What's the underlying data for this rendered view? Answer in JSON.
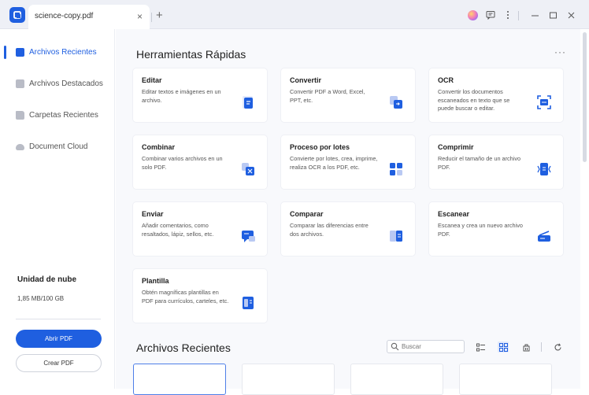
{
  "titlebar": {
    "tab_title": "science-copy.pdf",
    "close_glyph": "×",
    "new_tab_glyph": "+",
    "icons": [
      "app-logo-icon",
      "avatar-icon",
      "feedback-icon",
      "kebab-menu-icon",
      "minimize-icon",
      "maximize-icon",
      "close-icon"
    ]
  },
  "sidebar": {
    "items": [
      {
        "label": "Archivos Recientes",
        "icon": "recent-files-icon",
        "active": true
      },
      {
        "label": "Archivos Destacados",
        "icon": "starred-files-icon",
        "active": false
      },
      {
        "label": "Carpetas Recientes",
        "icon": "folder-icon",
        "active": false
      },
      {
        "label": "Document Cloud",
        "icon": "cloud-icon",
        "active": false
      }
    ],
    "cloud_title": "Unidad de nube",
    "cloud_usage": "1,85 MB/100 GB",
    "open_button": "Abrir PDF",
    "create_button": "Crear PDF"
  },
  "main": {
    "quick_tools_title": "Herramientas Rápidas",
    "more_glyph": "···",
    "tools": [
      {
        "title": "Editar",
        "desc": "Editar textos e imágenes en un archivo.",
        "icon": "edit-icon"
      },
      {
        "title": "Convertir",
        "desc": "Convertir PDF a Word, Excel, PPT, etc.",
        "icon": "convert-icon"
      },
      {
        "title": "OCR",
        "desc": "Convertir los documentos escaneados en texto que se puede buscar o editar.",
        "icon": "ocr-icon"
      },
      {
        "title": "Combinar",
        "desc": "Combinar varios archivos en un solo PDF.",
        "icon": "combine-icon"
      },
      {
        "title": "Proceso por lotes",
        "desc": "Convierte por lotes, crea, imprime, realiza OCR a los PDF, etc.",
        "icon": "batch-icon"
      },
      {
        "title": "Comprimir",
        "desc": "Reducir el tamaño de un archivo PDF.",
        "icon": "compress-icon"
      },
      {
        "title": "Enviar",
        "desc": "Añadir comentarios, como resaltados, lápiz, sellos, etc.",
        "icon": "send-icon"
      },
      {
        "title": "Comparar",
        "desc": "Comparar las diferencias entre dos archivos.",
        "icon": "compare-icon"
      },
      {
        "title": "Escanear",
        "desc": "Escanea y crea un nuevo archivo PDF.",
        "icon": "scanner-icon"
      },
      {
        "title": "Plantilla",
        "desc": "Obtén magníficas plantillas en PDF para currículos, carteles, etc.",
        "icon": "template-icon"
      }
    ],
    "recent_title": "Archivos Recientes",
    "search_placeholder": "Buscar",
    "view_icons": [
      "list-view-icon",
      "grid-view-icon",
      "clean-icon",
      "refresh-icon"
    ]
  },
  "colors": {
    "accent": "#1f5fe0",
    "background": "#f8f9fc"
  }
}
